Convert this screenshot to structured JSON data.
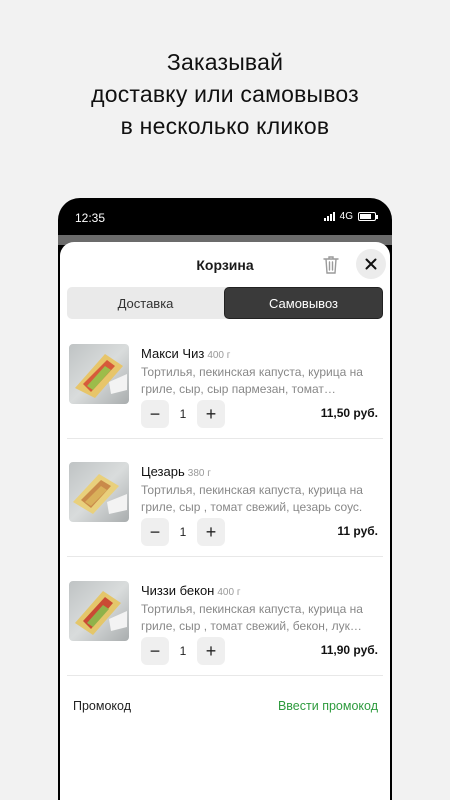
{
  "headline": {
    "line1": "Заказывай",
    "line2": "доставку или самовывоз",
    "line3": "в несколько кликов"
  },
  "statusbar": {
    "time": "12:35",
    "network": "4G"
  },
  "cart": {
    "title": "Корзина",
    "tabs": [
      {
        "label": "Доставка",
        "active": false
      },
      {
        "label": "Самовывоз",
        "active": true
      }
    ],
    "items": [
      {
        "name": "Макси Чиз",
        "weight": "400 г",
        "description": "Тортилья, пекинская капуста, курица на гриле, сыр, сыр пармезан, томат…",
        "quantity": "1",
        "price": "11,50 руб."
      },
      {
        "name": "Цезарь",
        "weight": "380 г",
        "description": "Тортилья, пекинская капуста, курица на гриле, сыр , томат свежий, цезарь соус.",
        "quantity": "1",
        "price": "11 руб."
      },
      {
        "name": "Чиззи бекон",
        "weight": "400 г",
        "description": "Тортилья, пекинская капуста, курица на гриле, сыр , томат свежий, бекон, лук…",
        "quantity": "1",
        "price": "11,90 руб."
      }
    ],
    "promo": {
      "label": "Промокод",
      "action": "Ввести промокод"
    },
    "minus": "−",
    "plus": "+"
  },
  "colors": {
    "accent_green": "#2e9b3e",
    "active_tab": "#3a3a3a"
  },
  "icons": [
    "trash-icon",
    "close-icon",
    "signal-icon",
    "battery-icon"
  ]
}
